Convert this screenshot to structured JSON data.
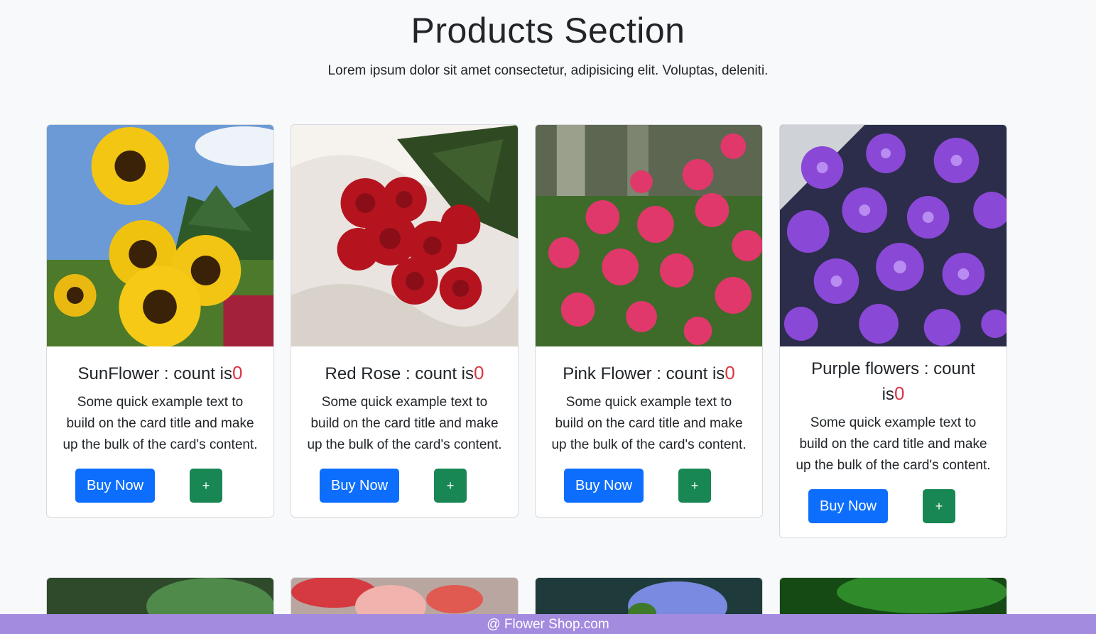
{
  "header": {
    "title": "Products Section",
    "subtitle": "Lorem ipsum dolor sit amet consectetur, adipisicing elit. Voluptas, deleniti."
  },
  "products": [
    {
      "name": "SunFlower : count is",
      "count": "0",
      "text": "Some quick example text to build on the card title and make up the bulk of the card's content.",
      "buy_label": "Buy Now",
      "add_label": "+",
      "image": "sunflower-image"
    },
    {
      "name": "Red Rose : count is",
      "count": "0",
      "text": "Some quick example text to build on the card title and make up the bulk of the card's content.",
      "buy_label": "Buy Now",
      "add_label": "+",
      "image": "red-rose-image"
    },
    {
      "name": "Pink Flower : count is",
      "count": "0",
      "text": "Some quick example text to build on the card title and make up the bulk of the card's content.",
      "buy_label": "Buy Now",
      "add_label": "+",
      "image": "pink-flower-image"
    },
    {
      "name": "Purple flowers : count is",
      "count": "0",
      "text": "Some quick example text to build on the card title and make up the bulk of the card's content.",
      "buy_label": "Buy Now",
      "add_label": "+",
      "image": "purple-flowers-image"
    }
  ],
  "footer": {
    "text": "@ Flower Shop.com"
  },
  "colors": {
    "primary": "#0d6efd",
    "success": "#198754",
    "count": "#dc3545",
    "footer_bg": "#a38be0"
  }
}
